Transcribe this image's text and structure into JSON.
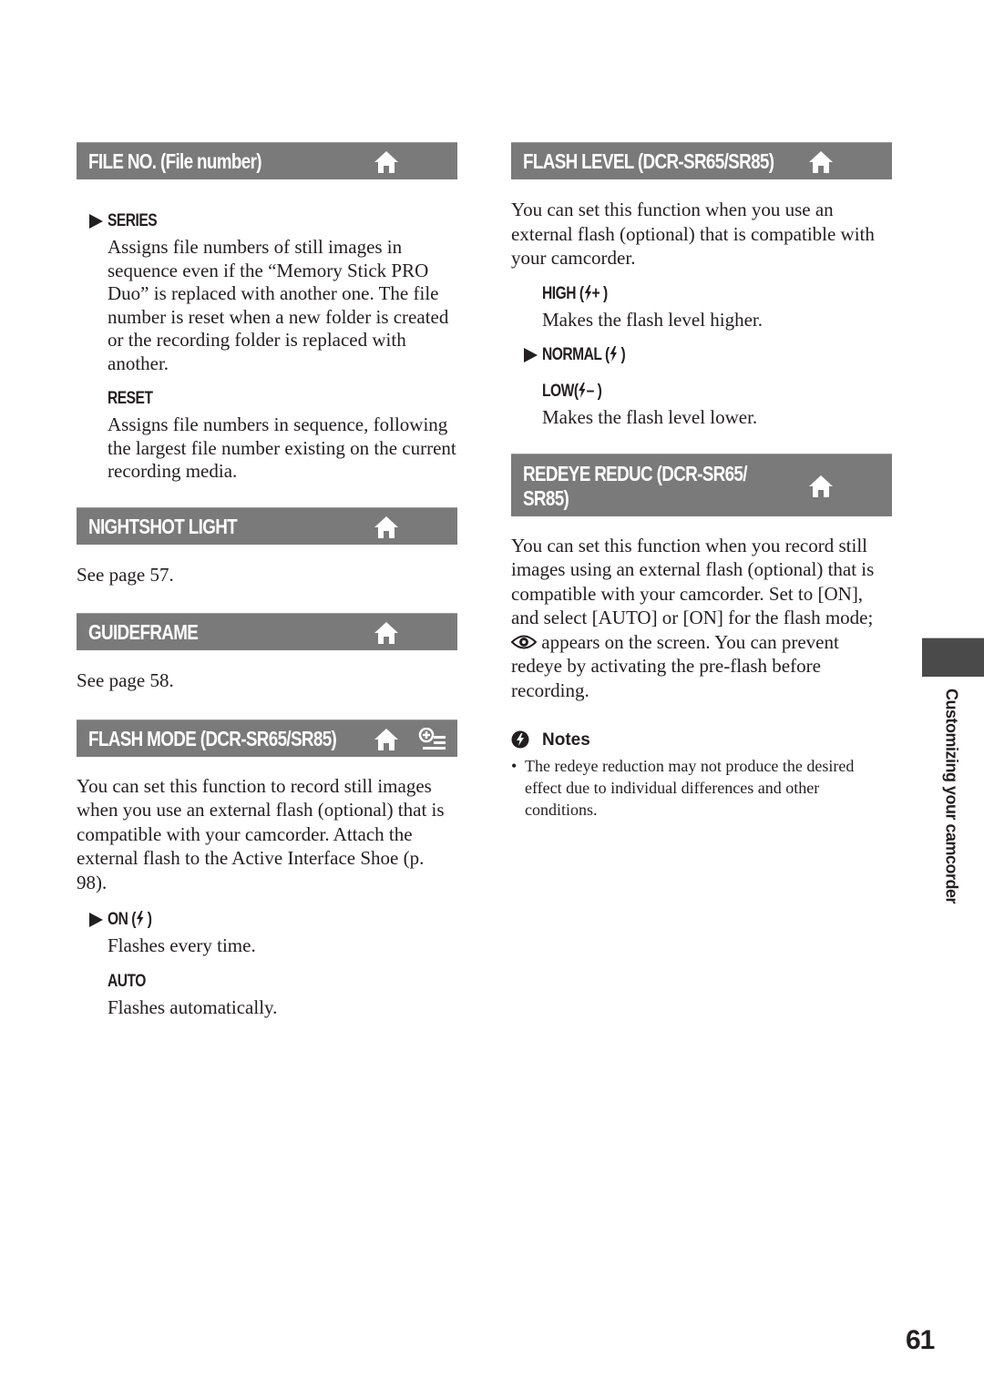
{
  "page": {
    "number": "61",
    "side_tab_label": "Customizing your camcorder",
    "colors": {
      "header_bar": "#7a7a7a",
      "side_tab": "#4a4a4a",
      "text": "#231f20"
    }
  },
  "left": {
    "file_no": {
      "title": "FILE NO. (File number)",
      "icon": "home-icon",
      "options": [
        {
          "label": "SERIES",
          "default": true,
          "desc": "Assigns file numbers of still images in sequence even if the “Memory Stick PRO Duo” is replaced with another one. The file number is reset when a new folder is created or the recording folder is replaced with another."
        },
        {
          "label": "RESET",
          "default": false,
          "desc": "Assigns file numbers in sequence, following the largest file number existing on the current recording media."
        }
      ]
    },
    "nightshot_light": {
      "title": "NIGHTSHOT LIGHT",
      "icon": "home-icon",
      "text": "See page 57."
    },
    "guideframe": {
      "title": "GUIDEFRAME",
      "icon": "home-icon",
      "text": "See page 58."
    },
    "flash_mode": {
      "title": "FLASH MODE (DCR-SR65/SR85)",
      "icons": [
        "home-icon",
        "plus-options-icon"
      ],
      "intro": "You can set this function to record still images when you use an external flash (optional) that is compatible with your camcorder. Attach the external flash to the Active Interface Shoe (p. 98).",
      "options": [
        {
          "label": "ON (",
          "suffix": ")",
          "icon": "flash-icon",
          "default": true,
          "desc": "Flashes every time."
        },
        {
          "label": "AUTO",
          "default": false,
          "desc": "Flashes automatically."
        }
      ]
    }
  },
  "right": {
    "flash_level": {
      "title": "FLASH LEVEL (DCR-SR65/SR85)",
      "icon": "home-icon",
      "intro": "You can set this function when you use an external flash (optional) that is compatible with your camcorder.",
      "options": [
        {
          "label": "HIGH (",
          "suffix": "+ )",
          "icon": "flash-icon",
          "default": false,
          "desc": "Makes the flash level higher."
        },
        {
          "label": "NORMAL (",
          "suffix": ")",
          "icon": "flash-icon",
          "default": true,
          "desc": ""
        },
        {
          "label": "LOW(",
          "suffix": "– )",
          "icon": "flash-icon",
          "default": false,
          "desc": "Makes the flash level lower."
        }
      ]
    },
    "redeye_reduc": {
      "title_line1": "REDEYE REDUC (DCR-SR65/",
      "title_line2": "SR85)",
      "icon": "home-icon",
      "intro_part1": "You can set this function when you record still images using an external flash (optional) that is compatible with your camcorder. Set to [ON], and select [AUTO] or [ON] for the flash mode;",
      "intro_icon": "redeye-icon",
      "intro_part2": "appears on the screen. You can prevent redeye by activating the pre-flash before recording.",
      "notes": {
        "heading": "Notes",
        "icon": "notes-icon",
        "items": [
          "The redeye reduction may not produce the desired effect due to individual differences and other conditions."
        ]
      }
    }
  }
}
